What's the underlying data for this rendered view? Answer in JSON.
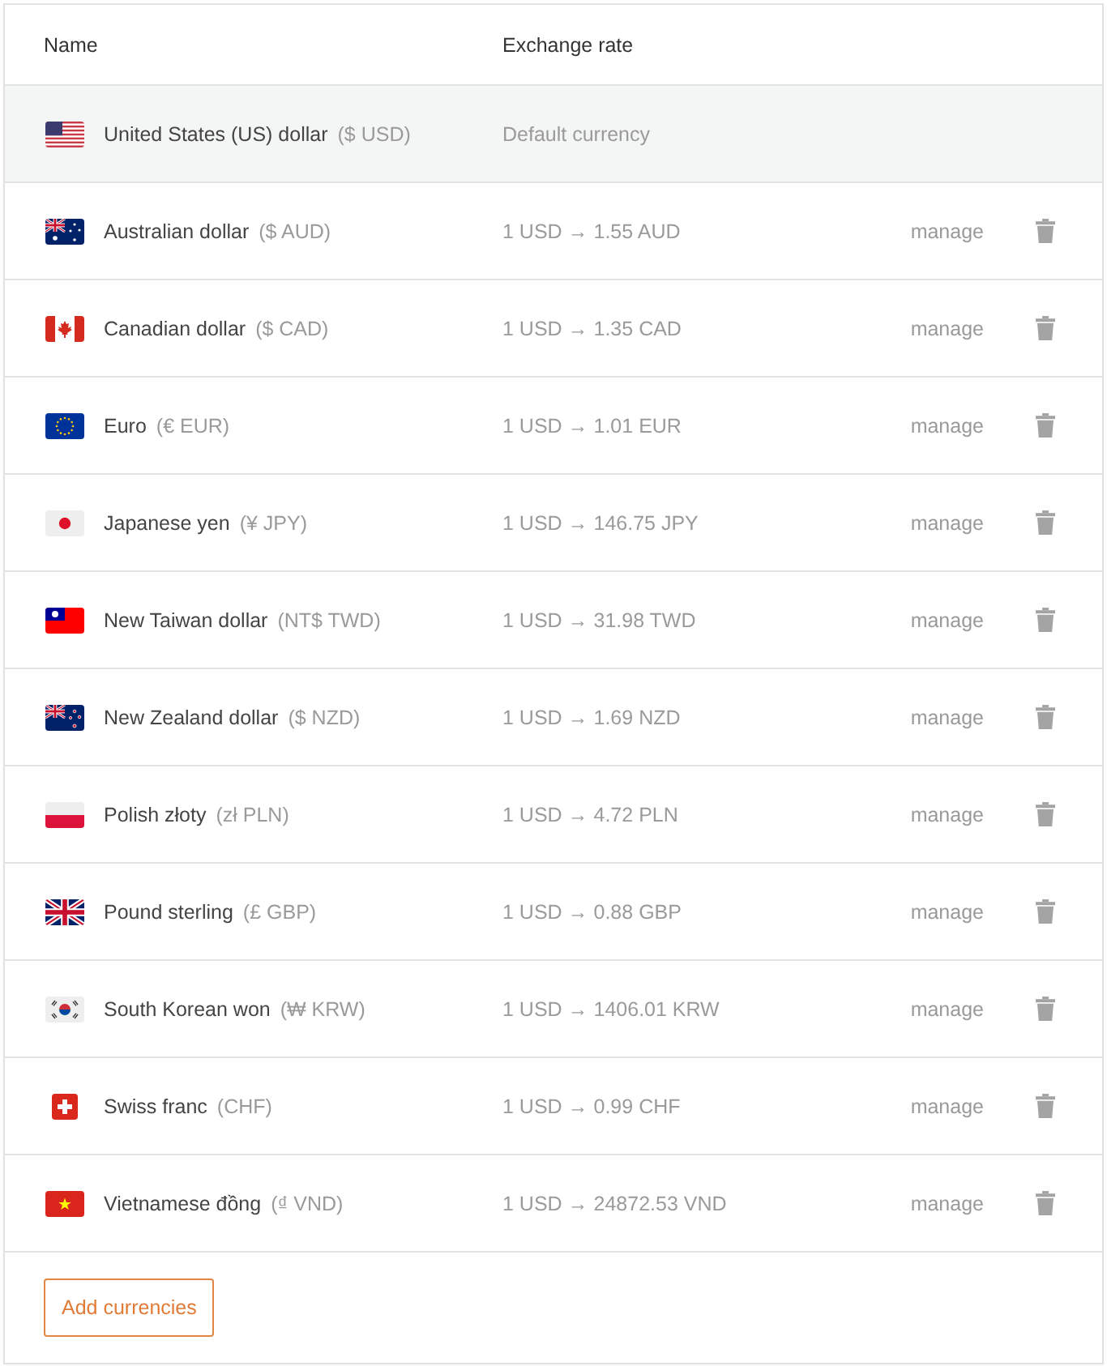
{
  "table": {
    "columns": [
      "Name",
      "Exchange rate"
    ],
    "rows": [
      {
        "name": "United States (US) dollar",
        "code": "($ USD)",
        "rate": "Default currency",
        "default": true
      },
      {
        "name": "Australian dollar",
        "code": "($ AUD)",
        "rate": "1 USD → 1.55 AUD",
        "default": false,
        "action": "manage"
      },
      {
        "name": "Canadian dollar",
        "code": "($ CAD)",
        "rate": "1 USD → 1.35 CAD",
        "default": false,
        "action": "manage"
      },
      {
        "name": "Euro",
        "code": "(€ EUR)",
        "rate": "1 USD → 1.01 EUR",
        "default": false,
        "action": "manage"
      },
      {
        "name": "Japanese yen",
        "code": "(¥ JPY)",
        "rate": "1 USD → 146.75 JPY",
        "default": false,
        "action": "manage"
      },
      {
        "name": "New Taiwan dollar",
        "code": "(NT$ TWD)",
        "rate": "1 USD → 31.98 TWD",
        "default": false,
        "action": "manage"
      },
      {
        "name": "New Zealand dollar",
        "code": "($ NZD)",
        "rate": "1 USD → 1.69 NZD",
        "default": false,
        "action": "manage"
      },
      {
        "name": "Polish złoty",
        "code": "(zł PLN)",
        "rate": "1 USD → 4.72 PLN",
        "default": false,
        "action": "manage"
      },
      {
        "name": "Pound sterling",
        "code": "(£ GBP)",
        "rate": "1 USD → 0.88 GBP",
        "default": false,
        "action": "manage"
      },
      {
        "name": "South Korean won",
        "code": "(₩ KRW)",
        "rate": "1 USD → 1406.01 KRW",
        "default": false,
        "action": "manage"
      },
      {
        "name": "Swiss franc",
        "code": "(CHF)",
        "rate": "1 USD → 0.99 CHF",
        "default": false,
        "action": "manage"
      },
      {
        "name": "Vietnamese đồng",
        "code": "(₫ VND)",
        "rate": "1 USD → 24872.53 VND",
        "default": false,
        "action": "manage"
      }
    ]
  },
  "add_button": "Add currencies"
}
